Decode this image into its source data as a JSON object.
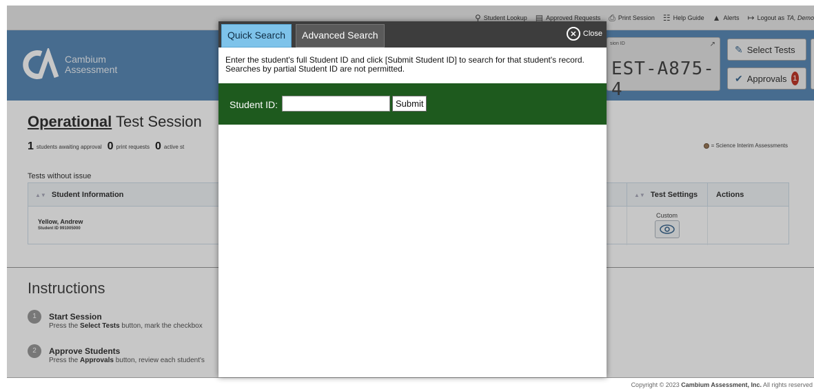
{
  "topbar": {
    "links": [
      {
        "label": "Student Lookup",
        "icon": "search-icon"
      },
      {
        "label": "Approved Requests",
        "icon": "document-icon"
      },
      {
        "label": "Print Session",
        "icon": "printer-icon"
      },
      {
        "label": "Help Guide",
        "icon": "book-icon"
      },
      {
        "label": "Alerts",
        "icon": "warning-icon"
      },
      {
        "label": "Logout as",
        "user": "TA, Demo",
        "icon": "logout-icon"
      }
    ]
  },
  "header": {
    "logo_line1": "Cambium",
    "logo_line2": "Assessment",
    "session_label": "sion ID",
    "session_id": "EST-A875-4",
    "select_tests_label": "Select Tests",
    "approvals_label": "Approvals",
    "approvals_count": "1"
  },
  "main": {
    "title_bold": "Operational",
    "title_rest": "Test Session",
    "stats": [
      {
        "num": "1",
        "label": "students awaiting approval"
      },
      {
        "num": "0",
        "label": "print requests"
      },
      {
        "num": "0",
        "label": "active st"
      }
    ],
    "legend": "= Science Interim Assessments",
    "section_label": "Tests without issue",
    "columns": {
      "student": "Student Information",
      "settings": "Test Settings",
      "actions": "Actions"
    },
    "rows": [
      {
        "name": "Yellow, Andrew",
        "student_id": "Student ID 991005000",
        "settings": "Custom"
      }
    ]
  },
  "instructions": {
    "title": "Instructions",
    "steps": [
      {
        "num": "1",
        "title": "Start Session",
        "pre": "Press the ",
        "bold": "Select Tests",
        "post": " button, mark the checkbox"
      },
      {
        "num": "2",
        "title": "Approve Students",
        "pre": "Press the ",
        "bold": "Approvals",
        "post": " button, review each student's"
      }
    ]
  },
  "footer": {
    "pre": "Copyright © 2023 ",
    "bold": "Cambium Assessment, Inc.",
    "post": " All rights reserved"
  },
  "modal": {
    "tab_quick": "Quick Search",
    "tab_advanced": "Advanced Search",
    "close_label": "Close",
    "instructions": "Enter the student's full Student ID and click [Submit Student ID] to search for that student's record. Searches by partial Student ID are not permitted.",
    "student_id_label": "Student ID:",
    "student_id_value": "",
    "submit_label": "Submit"
  }
}
